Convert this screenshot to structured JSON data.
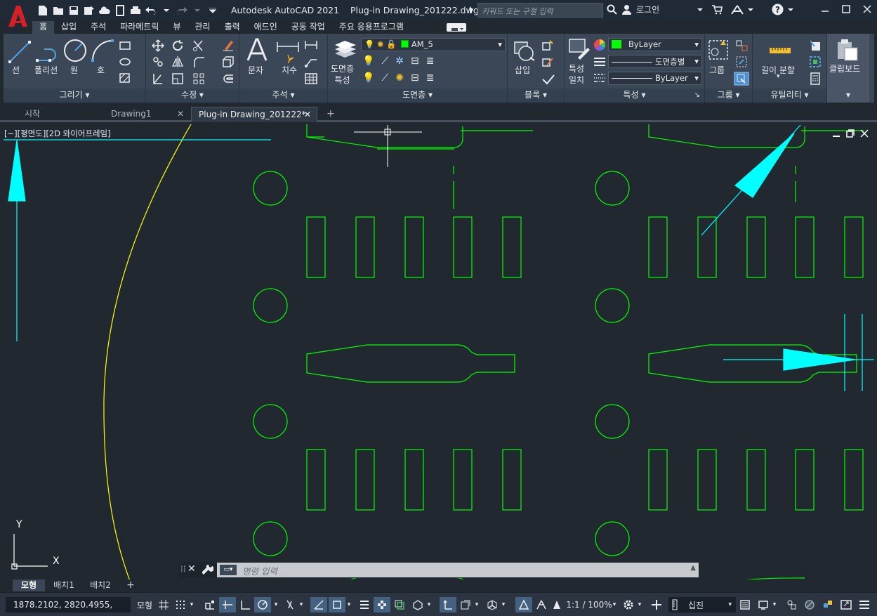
{
  "title": {
    "app": "Autodesk AutoCAD 2021",
    "file": "Plug-in Drawing_201222.dwg",
    "search_placeholder": "키워드 또는 구절 입력",
    "login": "로그인"
  },
  "menu_tabs": [
    "홈",
    "삽입",
    "주석",
    "파라메트릭",
    "뷰",
    "관리",
    "출력",
    "애드인",
    "공동 작업",
    "주요 응용프로그램"
  ],
  "ribbon": {
    "draw": {
      "line": "선",
      "polyline": "폴리선",
      "circle": "원",
      "arc": "호",
      "title": "그리기"
    },
    "modify": {
      "title": "수정"
    },
    "annotation": {
      "text": "문자",
      "dimension": "치수",
      "title": "주석"
    },
    "layers": {
      "properties_1": "도면층",
      "properties_2": "특성",
      "current_layer": "AM_5",
      "title": "도면층"
    },
    "block": {
      "insert": "삽입",
      "title": "블록"
    },
    "properties": {
      "match_1": "특성",
      "match_2": "일치",
      "color": "ByLayer",
      "linetype": "도면층별",
      "lineweight": "ByLayer",
      "title": "특성"
    },
    "groups": {
      "group": "그룹",
      "title": "그룹"
    },
    "utilities": {
      "measure": "길이 분할",
      "title": "유틸리티"
    },
    "clipboard": {
      "label": "클립보드"
    }
  },
  "doc_tabs": [
    "시작",
    "Drawing1",
    "Plug-in Drawing_201222*"
  ],
  "viewport": {
    "label": "[−][평면도][2D 와이어프레임]",
    "ucs_x": "X",
    "ucs_y": "Y"
  },
  "command": {
    "placeholder": "명령 입력"
  },
  "layout_tabs": [
    "모형",
    "배치1",
    "배치2"
  ],
  "status": {
    "coords": "1878.2102, 2820.4955, 0.0000",
    "model": "모형",
    "scale": "1:1 / 100%",
    "units": "십진"
  },
  "colors": {
    "background": "#212830",
    "geometry": "#00ff00",
    "arc": "#ffff00",
    "accent": "#00ffff",
    "logo": "#d42027"
  }
}
